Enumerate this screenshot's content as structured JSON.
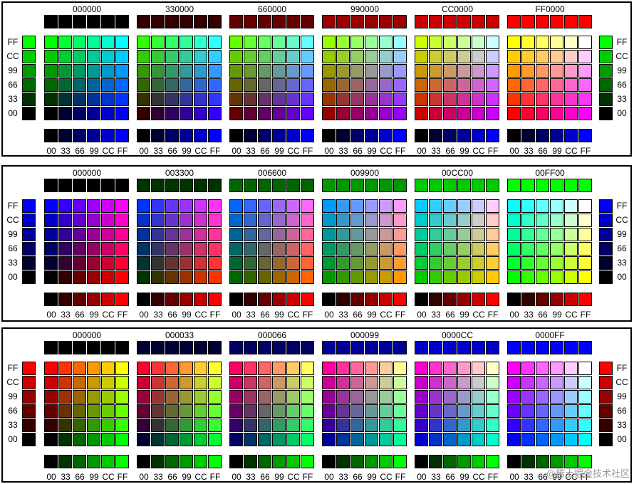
{
  "levels": [
    "00",
    "33",
    "66",
    "99",
    "CC",
    "FF"
  ],
  "row_labels": [
    "FF",
    "CC",
    "99",
    "66",
    "33",
    "00"
  ],
  "col_labels": [
    "00",
    "33",
    "66",
    "99",
    "CC",
    "FF"
  ],
  "panels": [
    {
      "fixed_channel": "r",
      "vert_channel": "g",
      "horiz_channel": "b",
      "blocks": [
        "000000",
        "330000",
        "660000",
        "990000",
        "CC0000",
        "FF0000"
      ]
    },
    {
      "fixed_channel": "g",
      "vert_channel": "b",
      "horiz_channel": "r",
      "blocks": [
        "000000",
        "003300",
        "006600",
        "009900",
        "00CC00",
        "00FF00"
      ]
    },
    {
      "fixed_channel": "b",
      "vert_channel": "r",
      "horiz_channel": "g",
      "blocks": [
        "000000",
        "000033",
        "000066",
        "000099",
        "0000CC",
        "0000FF"
      ]
    }
  ],
  "watermark": "@稀土掘金技术社区"
}
